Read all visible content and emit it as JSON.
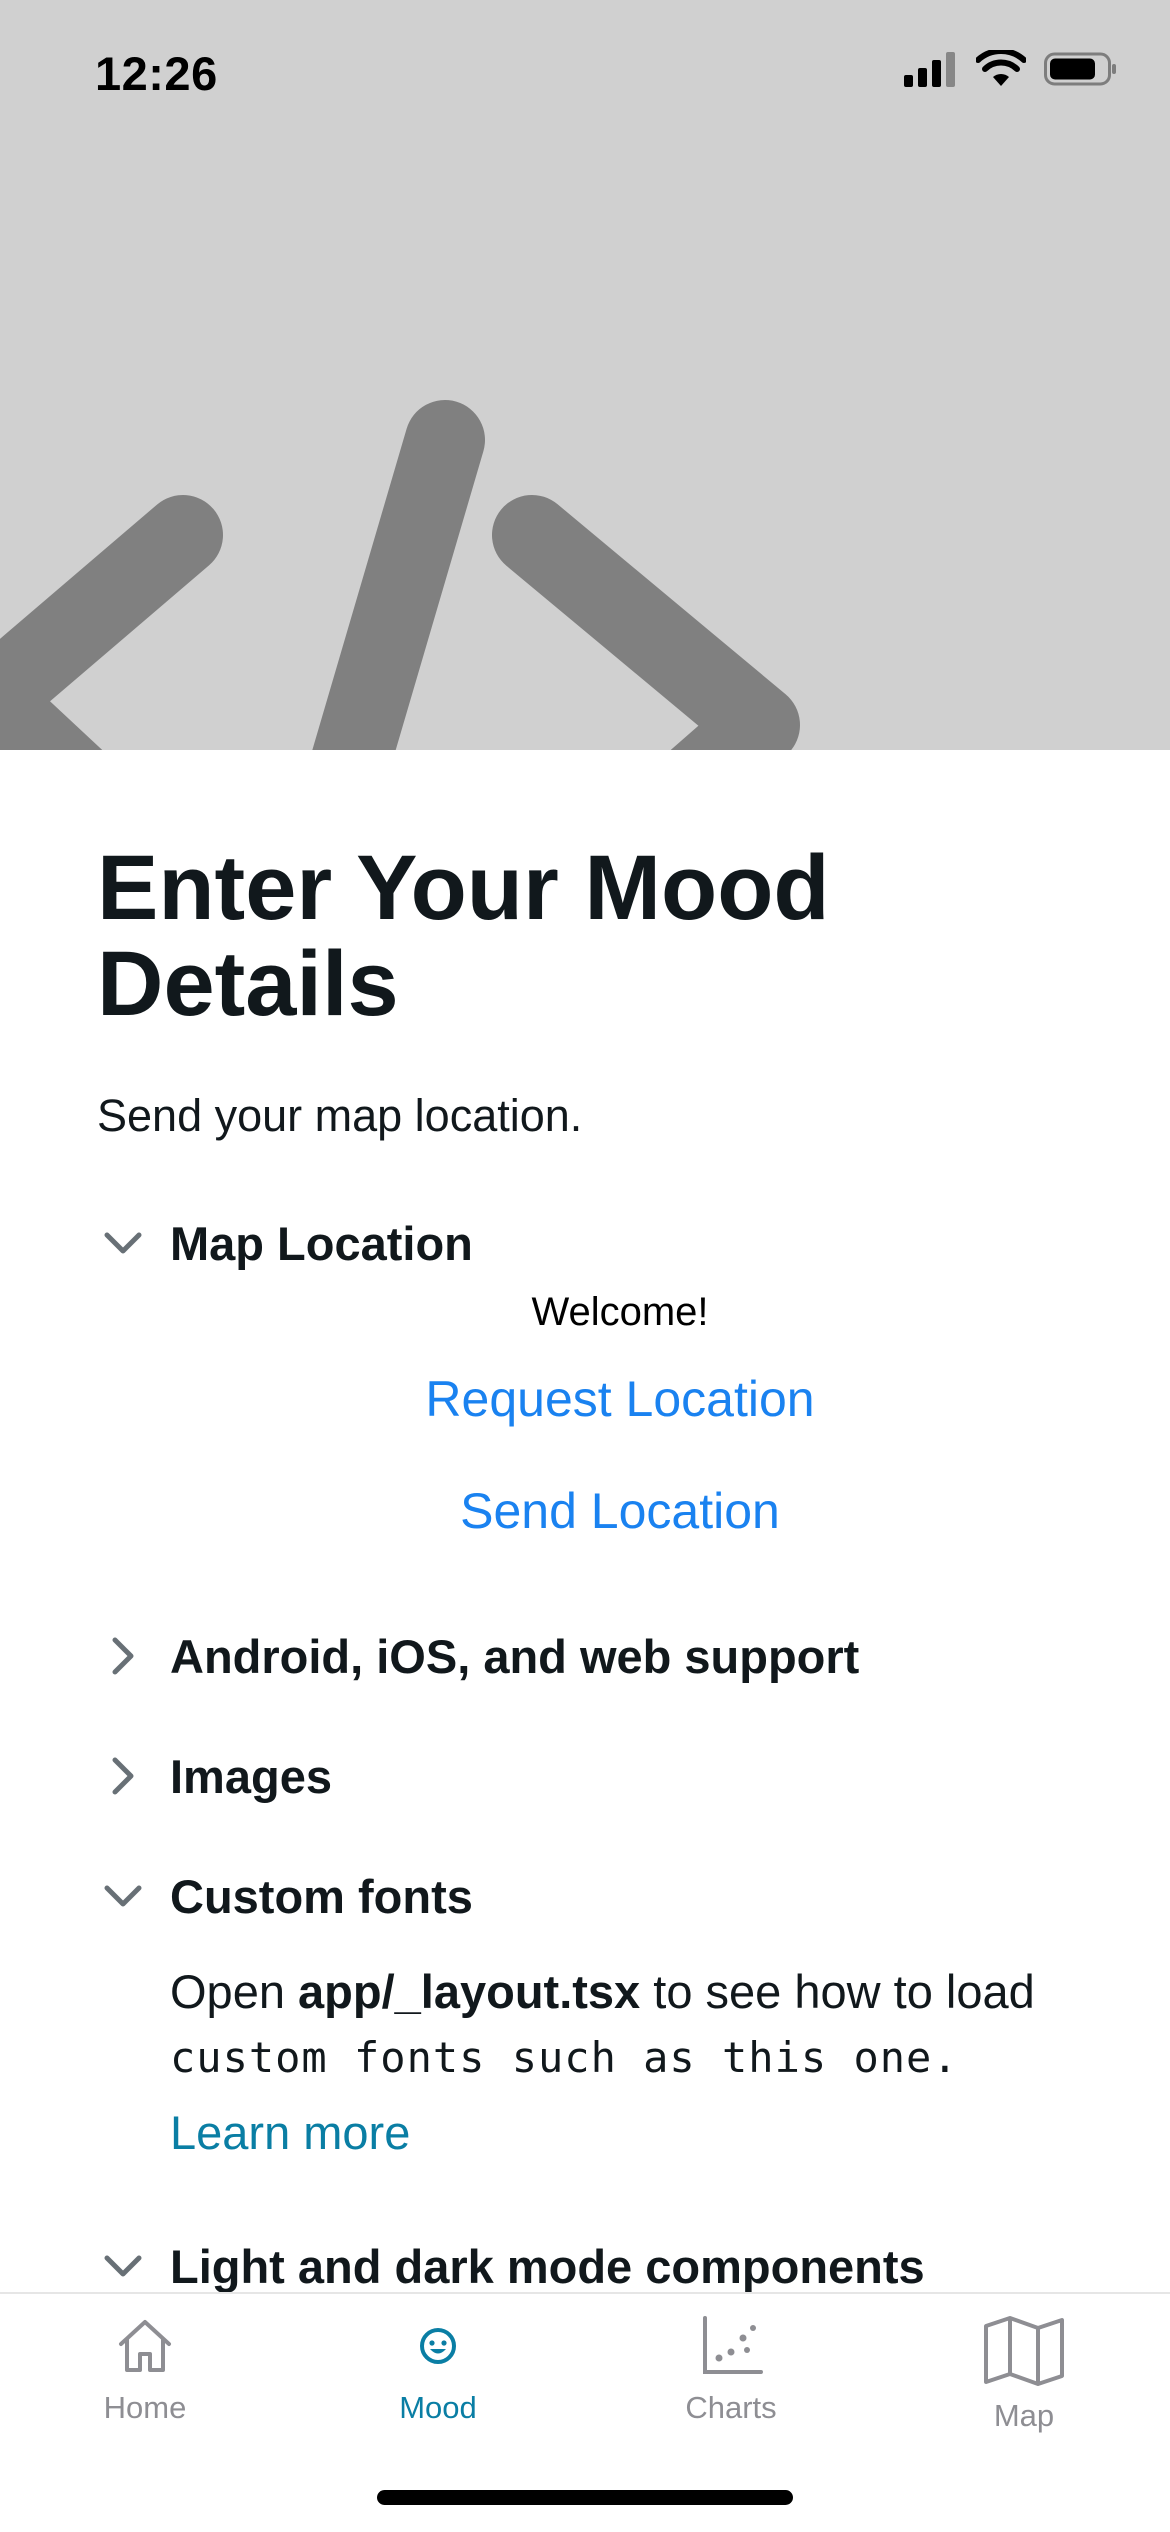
{
  "status_bar": {
    "time": "12:26",
    "icons": [
      "cellular-signal-icon",
      "wifi-icon",
      "battery-icon"
    ]
  },
  "header": {
    "background": "#d0d0d0",
    "hero_icon": "code-brackets-icon",
    "hero_color": "#808080"
  },
  "page": {
    "title": "Enter Your Mood Details",
    "subtitle": "Send your map location."
  },
  "sections": [
    {
      "title": "Map Location",
      "expanded": true,
      "welcome": "Welcome!",
      "request_button": "Request Location",
      "send_button": "Send Location"
    },
    {
      "title": "Android, iOS, and web support",
      "expanded": false
    },
    {
      "title": "Images",
      "expanded": false
    },
    {
      "title": "Custom fonts",
      "expanded": true,
      "text_before": "Open ",
      "text_bold": "app/_layout.tsx",
      "text_after": " to see how to load",
      "mono_text": "custom fonts such as this one.",
      "link": "Learn more"
    },
    {
      "title": "Light and dark mode components",
      "expanded": true
    }
  ],
  "tabbar": {
    "active": "Mood",
    "active_color": "#0a7ea4",
    "inactive_color": "#8e8e93",
    "tabs": [
      {
        "label": "Home",
        "icon": "house-icon"
      },
      {
        "label": "Mood",
        "icon": "smiley-face-icon"
      },
      {
        "label": "Charts",
        "icon": "scatter-chart-icon"
      },
      {
        "label": "Map",
        "icon": "folded-map-icon"
      }
    ]
  },
  "colors": {
    "link_blue": "#1a82f0",
    "accent_teal": "#0a7ea4",
    "text_dark": "#11181c"
  }
}
